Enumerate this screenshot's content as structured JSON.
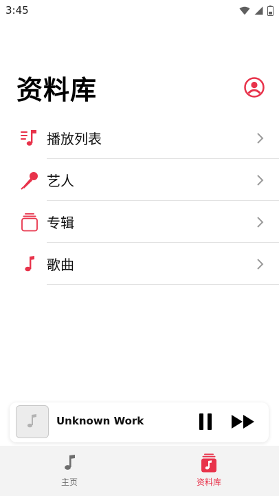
{
  "status_bar": {
    "time": "3:45"
  },
  "header": {
    "title": "资料库"
  },
  "accent_color": "#e8334b",
  "menu": {
    "items": [
      {
        "label": "播放列表",
        "icon": "playlist-icon"
      },
      {
        "label": "艺人",
        "icon": "microphone-icon"
      },
      {
        "label": "专辑",
        "icon": "album-stack-icon"
      },
      {
        "label": "歌曲",
        "icon": "music-note-icon"
      }
    ]
  },
  "mini_player": {
    "title": "Unknown Work"
  },
  "tab_bar": {
    "tabs": [
      {
        "label": "主页",
        "icon": "music-note-icon",
        "selected": false
      },
      {
        "label": "资料库",
        "icon": "library-icon",
        "selected": true
      }
    ]
  }
}
